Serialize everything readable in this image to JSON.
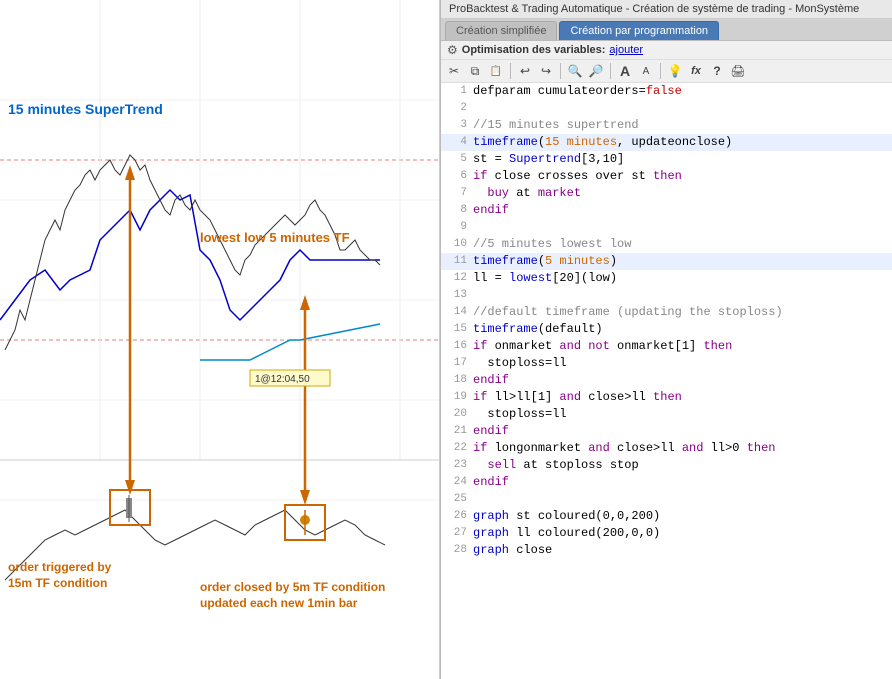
{
  "window": {
    "title": "ProBacktest & Trading Automatique - Création de système de trading - MonSystème"
  },
  "tabs": [
    {
      "label": "Création simplifiée",
      "active": false
    },
    {
      "label": "Création par programmation",
      "active": true
    }
  ],
  "toolbar": {
    "optimization_label": "Optimisation des variables:",
    "ajouter_label": "ajouter"
  },
  "code_lines": [
    {
      "num": 1,
      "content": "defparam cumulateorders=false"
    },
    {
      "num": 2,
      "content": ""
    },
    {
      "num": 3,
      "content": "//15 minutes supertrend"
    },
    {
      "num": 4,
      "content": "timeframe(15 minutes, updateonclose)"
    },
    {
      "num": 5,
      "content": "st = Supertrend[3,10]"
    },
    {
      "num": 6,
      "content": "if close crosses over st then"
    },
    {
      "num": 7,
      "content": "  buy at market"
    },
    {
      "num": 8,
      "content": "endif"
    },
    {
      "num": 9,
      "content": ""
    },
    {
      "num": 10,
      "content": "//5 minutes lowest low"
    },
    {
      "num": 11,
      "content": "timeframe(5 minutes)"
    },
    {
      "num": 12,
      "content": "ll = lowest[20](low)"
    },
    {
      "num": 13,
      "content": ""
    },
    {
      "num": 14,
      "content": "//default timeframe (updating the stoploss)"
    },
    {
      "num": 15,
      "content": "timeframe(default)"
    },
    {
      "num": 16,
      "content": "if onmarket and not onmarket[1] then"
    },
    {
      "num": 17,
      "content": "  stoploss=ll"
    },
    {
      "num": 18,
      "content": "endif"
    },
    {
      "num": 19,
      "content": "if ll>ll[1] and close>ll then"
    },
    {
      "num": 20,
      "content": "  stoploss=ll"
    },
    {
      "num": 21,
      "content": "endif"
    },
    {
      "num": 22,
      "content": "if longonmarket and close>ll and ll>0 then"
    },
    {
      "num": 23,
      "content": "  sell at stoploss stop"
    },
    {
      "num": 24,
      "content": "endif"
    },
    {
      "num": 25,
      "content": ""
    },
    {
      "num": 26,
      "content": "graph st coloured(0,0,200)"
    },
    {
      "num": 27,
      "content": "graph ll coloured(200,0,0)"
    },
    {
      "num": 28,
      "content": "graph close"
    }
  ],
  "annotations": {
    "supertrend_label": "15 minutes\nSuperTrend",
    "lowest_low_label": "lowest low\n5 minutes TF",
    "order_triggered_label": "order triggered by\n15m TF condition",
    "order_closed_label": "order closed by 5m TF condition\nupdated each new 1min bar",
    "price_label": "1@12:04,50"
  },
  "icons": {
    "scissors": "✂",
    "copy": "⧉",
    "paste": "📋",
    "undo": "↩",
    "redo": "↪",
    "search": "🔍",
    "zoom_in": "🔎",
    "font_a_big": "A",
    "font_a_small": "a",
    "bulb": "💡",
    "fx": "fx",
    "question": "?",
    "print": "🖨"
  }
}
